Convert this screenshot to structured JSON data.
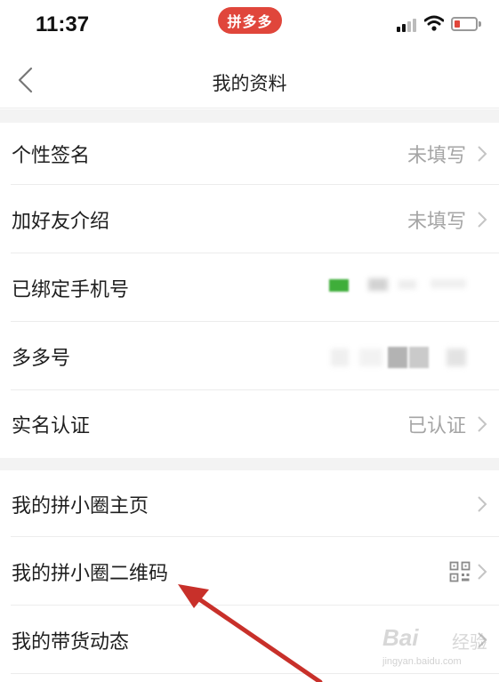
{
  "status_bar": {
    "time": "11:37",
    "app_badge": "拼多多",
    "icons": [
      "signal-icon",
      "wifi-icon",
      "battery-low-icon"
    ],
    "accent_color": "#e0463b"
  },
  "nav": {
    "title": "我的资料",
    "back_icon": "chevron-left-icon"
  },
  "rows_group_1": [
    {
      "label": "个性签名",
      "value": "未填写"
    },
    {
      "label": "加好友介绍",
      "value": "未填写"
    },
    {
      "label": "已绑定手机号",
      "value": ""
    },
    {
      "label": "多多号",
      "value": ""
    },
    {
      "label": "实名认证",
      "value": "已认证"
    }
  ],
  "rows_group_2": [
    {
      "label": "我的拼小圈主页"
    },
    {
      "label": "我的拼小圈二维码",
      "icon": "qr-code-icon"
    },
    {
      "label": "我的带货动态"
    }
  ],
  "watermark": {
    "logo": "Bai",
    "logo_cn": "经验",
    "url": "jingyan.baidu.com"
  }
}
